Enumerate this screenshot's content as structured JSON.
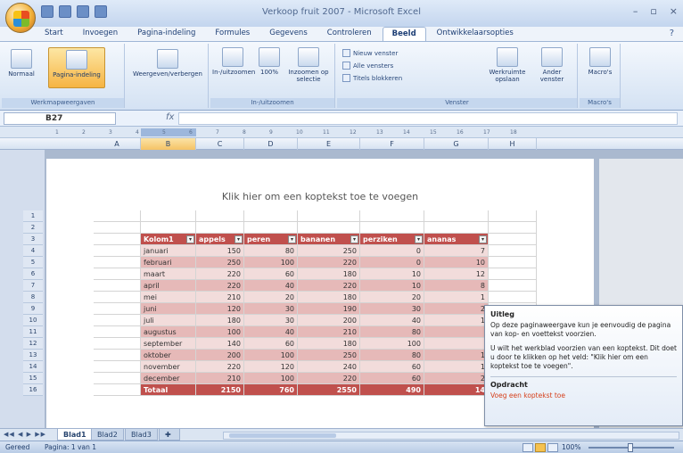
{
  "window": {
    "title": "Verkoop fruit 2007 - Microsoft Excel"
  },
  "ribbon_tabs": [
    "Start",
    "Invoegen",
    "Pagina-indeling",
    "Formules",
    "Gegevens",
    "Controleren",
    "Beeld",
    "Ontwikkelaarsopties"
  ],
  "active_tab": "Beeld",
  "ribbon": {
    "views": {
      "normal": "Normaal",
      "page_layout": "Pagina-indeling",
      "group": "Werkmapweergaven"
    },
    "show_hide": {
      "label": "Weergeven/verbergen"
    },
    "zoom": {
      "zoom": "In-/uitzoomen",
      "hundred": "100%",
      "selection": "Inzoomen op selectie",
      "group": "In-/uitzoomen"
    },
    "window": {
      "new_window": "Nieuw venster",
      "arrange": "Alle vensters",
      "freeze": "Titels blokkeren",
      "save_workspace": "Werkruimte opslaan",
      "switch": "Ander venster",
      "group": "Venster"
    },
    "macros": {
      "label": "Macro's",
      "group": "Macro's"
    }
  },
  "formula_bar": {
    "cell_ref": "B27",
    "fx": "fx",
    "value": ""
  },
  "ruler": {
    "marks": [
      "1",
      "2",
      "3",
      "4",
      "5",
      "6",
      "7",
      "8",
      "9",
      "10",
      "11",
      "12",
      "13",
      "14",
      "15",
      "16",
      "17",
      "18"
    ]
  },
  "columns": [
    "A",
    "B",
    "C",
    "D",
    "E",
    "F",
    "G",
    "H"
  ],
  "selected_column": "B",
  "rows": [
    "1",
    "2",
    "3",
    "4",
    "5",
    "6",
    "7",
    "8",
    "9",
    "10",
    "11",
    "12",
    "13",
    "14",
    "15",
    "16"
  ],
  "header_hint": "Klik hier om een koptekst toe te voegen",
  "table": {
    "headers": [
      "Kolom1",
      "appels",
      "peren",
      "bananen",
      "perziken",
      "ananas"
    ],
    "rows": [
      [
        "januari",
        "150",
        "80",
        "250",
        "0",
        "7"
      ],
      [
        "februari",
        "250",
        "100",
        "220",
        "0",
        "10"
      ],
      [
        "maart",
        "220",
        "60",
        "180",
        "10",
        "12"
      ],
      [
        "april",
        "220",
        "40",
        "220",
        "10",
        "8"
      ],
      [
        "mei",
        "210",
        "20",
        "180",
        "20",
        "1"
      ],
      [
        "juni",
        "120",
        "30",
        "190",
        "30",
        "2"
      ],
      [
        "juli",
        "180",
        "30",
        "200",
        "40",
        "1"
      ],
      [
        "augustus",
        "100",
        "40",
        "210",
        "80",
        ""
      ],
      [
        "september",
        "140",
        "60",
        "180",
        "100",
        ""
      ],
      [
        "oktober",
        "200",
        "100",
        "250",
        "80",
        "1"
      ],
      [
        "november",
        "220",
        "120",
        "240",
        "60",
        "1"
      ],
      [
        "december",
        "210",
        "100",
        "220",
        "60",
        "2"
      ],
      [
        "Totaal",
        "2150",
        "760",
        "2550",
        "490",
        "14"
      ]
    ]
  },
  "tooltip": {
    "title": "Uitleg",
    "line1": "Op deze paginaweergave kun je eenvoudig de pagina van kop- en voettekst voorzien.",
    "line2": "U wilt het werkblad voorzien van een koptekst. Dit doet u door te klikken op het veld: \"Klik hier om een koptekst toe te voegen\".",
    "task_title": "Opdracht",
    "task": "Voeg een koptekst toe"
  },
  "sheet_tabs": [
    "Blad1",
    "Blad2",
    "Blad3"
  ],
  "active_sheet": "Blad1",
  "status": {
    "mode": "Gereed",
    "page": "Pagina: 1 van 1",
    "zoom": "100%"
  }
}
